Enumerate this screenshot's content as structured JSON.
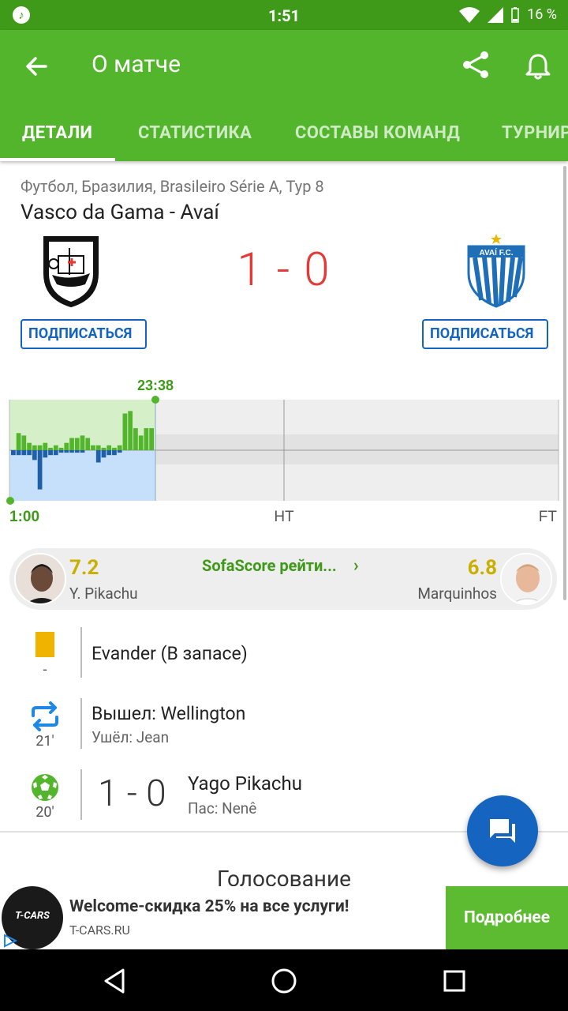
{
  "status_bar": {
    "time": "1:51",
    "battery": "16 %"
  },
  "app_bar": {
    "title": "О матче"
  },
  "tabs": [
    {
      "label": "ДЕТАЛИ"
    },
    {
      "label": "СТАТИСТИКА"
    },
    {
      "label": "СОСТАВЫ КОМАНД"
    },
    {
      "label": "ТУРНИР"
    }
  ],
  "match": {
    "breadcrumb": "Футбол, Бразилия, Brasileiro Série A, Тур 8",
    "title": "Vasco da Gama - Avaí",
    "score": "1 - 0",
    "home_subscribe": "ПОДПИСАТЬСЯ",
    "away_subscribe": "ПОДПИСАТЬСЯ",
    "away_logo_text": "AVAÍ F.C."
  },
  "chart_data": {
    "type": "bar",
    "current_time_label": "23:38",
    "x_labels": [
      "1:00",
      "HT",
      "FT"
    ],
    "home_pressure": [
      0.0,
      0.35,
      0.3,
      0.15,
      0.1,
      0.1,
      0.15,
      0.05,
      0.1,
      0.05,
      0.15,
      0.25,
      0.25,
      0.3,
      0.25,
      0.1,
      0.1,
      0.05,
      0.1,
      0.05,
      0.1,
      0.75,
      0.8,
      0.45,
      0.3,
      0.45,
      0.45
    ],
    "away_pressure": [
      0.1,
      0.1,
      0.1,
      0.1,
      0.2,
      0.8,
      0.15,
      0.1,
      0.1,
      0.05,
      0.05,
      0.05,
      0.05,
      0.05,
      0.0,
      0.0,
      0.25,
      0.15,
      0.1,
      0.1,
      0.05,
      0.0,
      0.0,
      0.0,
      0.0,
      0.0,
      0.0
    ]
  },
  "ratings": {
    "home_value": "7.2",
    "home_player": "Y. Pikachu",
    "link": "SofaScore рейти...",
    "away_value": "6.8",
    "away_player": "Marquinhos"
  },
  "events": {
    "card": {
      "text": "Evander (В запасе)",
      "minute": "-"
    },
    "sub": {
      "in": "Вышел: Wellington",
      "out": "Ушёл: Jean",
      "minute": "21'"
    },
    "goal": {
      "score": "1 - 0",
      "scorer": "Yago Pikachu",
      "assist": "Пас: Nenê",
      "minute": "20'"
    }
  },
  "vote_title": "Голосование",
  "ad": {
    "logo_text": "T-CARS",
    "title": "Welcome-скидка 25% на все услуги!",
    "url": "T-CARS.RU",
    "button": "Подробнее"
  }
}
